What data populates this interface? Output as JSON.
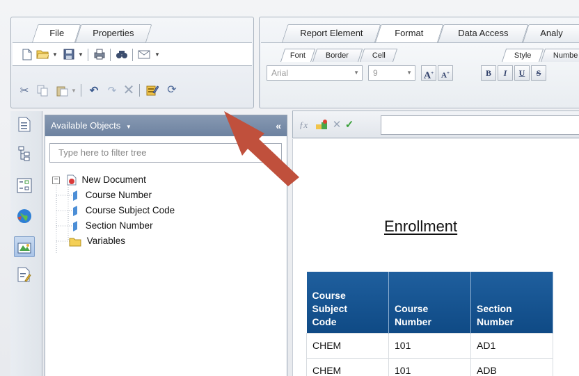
{
  "tabs_left": [
    "File",
    "Properties"
  ],
  "tabs_right": [
    "Report Element",
    "Format",
    "Data Access",
    "Analy"
  ],
  "subtabs_left": [
    "Font",
    "Border",
    "Cell"
  ],
  "subtabs_right": [
    "Style",
    "Numbe"
  ],
  "font_name": "Arial",
  "font_size": "9",
  "format_buttons": [
    "B",
    "I",
    "U",
    "S"
  ],
  "available_objects": {
    "title": "Available Objects",
    "collapse": "«",
    "filter_placeholder": "Type here to filter tree",
    "tree": [
      {
        "label": "New Document",
        "type": "document"
      },
      {
        "label": "Course Number",
        "type": "dimension"
      },
      {
        "label": "Course Subject Code",
        "type": "dimension"
      },
      {
        "label": "Section Number",
        "type": "dimension"
      },
      {
        "label": "Variables",
        "type": "folder"
      }
    ]
  },
  "report": {
    "title": "Enrollment",
    "columns": [
      "Course Subject Code",
      "Course Number",
      "Section Number"
    ],
    "rows": [
      [
        "CHEM",
        "101",
        "AD1"
      ],
      [
        "CHEM",
        "101",
        "ADB"
      ]
    ]
  },
  "colors": {
    "header_blue": "#1f5f9e",
    "panel_header": "#7b8fab",
    "arrow": "#c0503c"
  },
  "icons": {
    "toolbar_row1": [
      "new-document-icon",
      "open-folder-icon",
      "save-icon",
      "print-icon",
      "find-icon",
      "email-icon"
    ],
    "toolbar_row2": [
      "cut-icon",
      "copy-icon",
      "paste-icon",
      "undo-icon",
      "redo-icon",
      "delete-icon",
      "edit-query-icon",
      "refresh-icon"
    ],
    "side": [
      "document-summary-icon",
      "navigation-map-icon",
      "input-controls-icon",
      "data-access-icon",
      "available-objects-icon",
      "document-structure-icon"
    ]
  }
}
